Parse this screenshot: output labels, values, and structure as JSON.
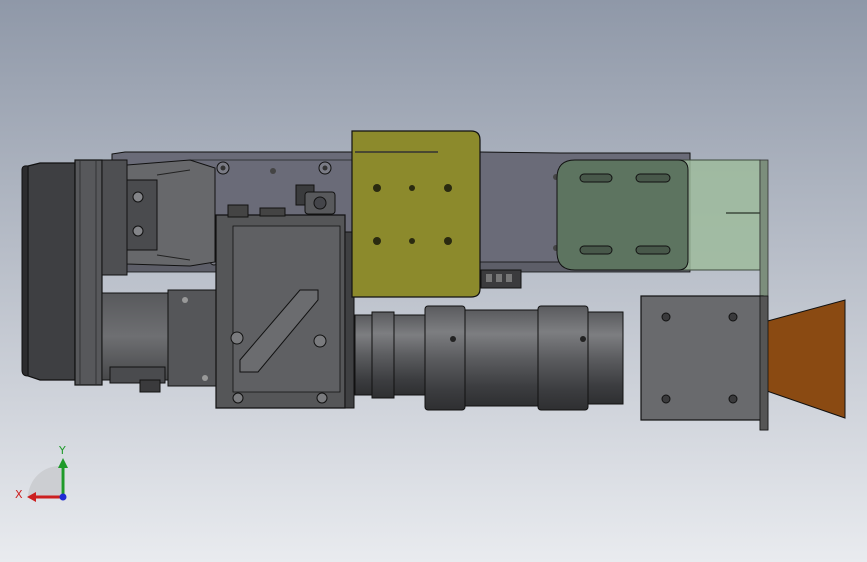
{
  "viewport": {
    "background_top": "#8f98a8",
    "background_bottom": "#e9ebef"
  },
  "colors": {
    "outline": "#111111",
    "dark_metal": "#4a4a4c",
    "metal": "#616163",
    "light_metal": "#77787b",
    "plate_gray": "#6a6b78",
    "olive_plate": "#8c8a2c",
    "green_plate": "#5d7460",
    "translucent_green": "#9dbb9c",
    "horn": "#8a4a12",
    "gray_box": "#696a6d"
  },
  "triad": {
    "x_label": "X",
    "y_label": "Y",
    "x_color": "#cc1f1f",
    "y_color": "#1f9a2a",
    "z_color": "#1f2ad4"
  },
  "icons": {
    "triad": "coordinate-triad-icon"
  }
}
